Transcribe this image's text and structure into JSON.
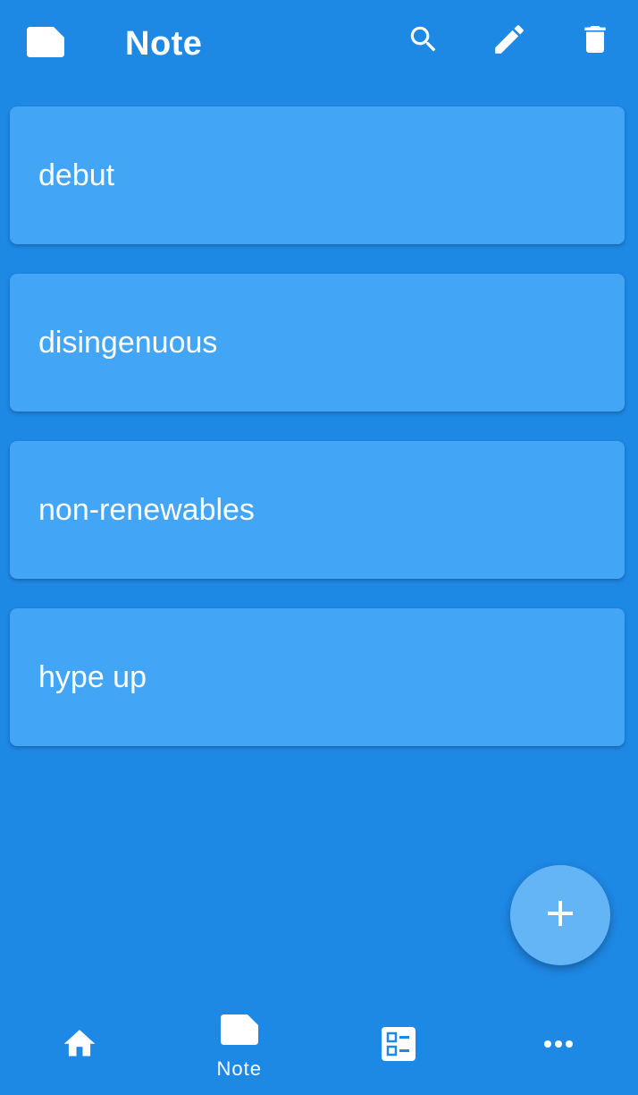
{
  "appbar": {
    "title": "Note",
    "icons": {
      "app": "note-icon",
      "search": "search-icon",
      "edit": "pencil-icon",
      "delete": "trash-icon"
    }
  },
  "notes": [
    {
      "text": "debut"
    },
    {
      "text": "disingenuous"
    },
    {
      "text": "non-renewables"
    },
    {
      "text": "hype up"
    }
  ],
  "fab": {
    "icon": "plus-icon"
  },
  "bottom_nav": {
    "items": [
      {
        "icon": "home-icon",
        "label": ""
      },
      {
        "icon": "note-icon",
        "label": "Note",
        "selected": true
      },
      {
        "icon": "checklist-icon",
        "label": ""
      },
      {
        "icon": "more-horizontal-icon",
        "label": ""
      }
    ]
  },
  "colors": {
    "background": "#1e88e5",
    "card": "#42a5f5",
    "fab": "#64b5f6",
    "text": "#ffffff"
  }
}
